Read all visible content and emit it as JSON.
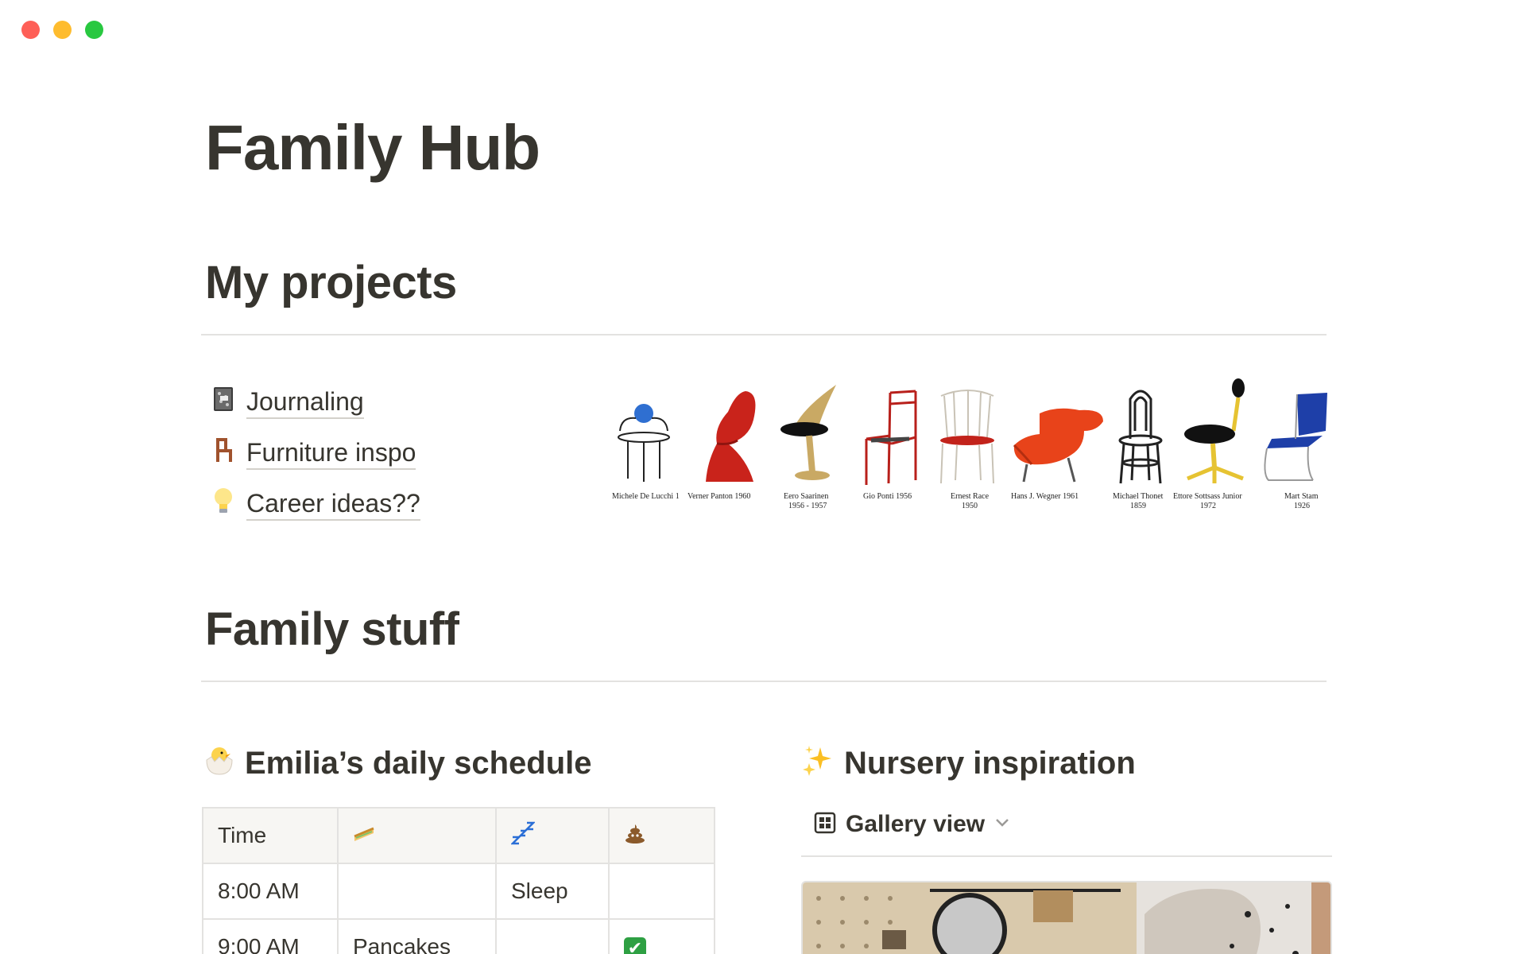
{
  "page": {
    "title": "Family Hub"
  },
  "sections": {
    "projects": {
      "heading": "My projects"
    },
    "family": {
      "heading": "Family stuff"
    }
  },
  "projects": [
    {
      "icon": "notebook-icon",
      "label": "Journaling"
    },
    {
      "icon": "chair-icon",
      "label": "Furniture inspo"
    },
    {
      "icon": "lightbulb-icon",
      "label": "Career ideas??"
    }
  ],
  "chairs": [
    {
      "label": "Michele De Lucchi 1"
    },
    {
      "label": "Verner Panton 1960"
    },
    {
      "label": "Eero Saarinen",
      "label2": "1956 - 1957"
    },
    {
      "label": "Gio Ponti  1956"
    },
    {
      "label": "Ernest Race",
      "label2": "1950"
    },
    {
      "label": "Hans J. Wegner 1961"
    },
    {
      "label": "Michael Thonet",
      "label2": "1859"
    },
    {
      "label": "Ettore Sottsass Junior",
      "label2": "1972"
    },
    {
      "label": "Mart Stam",
      "label2": "1926"
    }
  ],
  "schedule": {
    "heading": "Emilia’s daily schedule",
    "heading_icon": "hatching-chick-icon",
    "columns": [
      {
        "label": "Time",
        "icon": ""
      },
      {
        "label": "",
        "icon": "sandwich-icon"
      },
      {
        "label": "",
        "icon": "zzz-icon"
      },
      {
        "label": "",
        "icon": "poop-icon"
      }
    ],
    "rows": [
      {
        "time": "8:00 AM",
        "food": "",
        "sleep": "Sleep",
        "poo": ""
      },
      {
        "time": "9:00 AM",
        "food": "Pancakes",
        "sleep": "",
        "poo": "✔"
      }
    ]
  },
  "nursery": {
    "heading": "Nursery inspiration",
    "heading_icon": "sparkles-icon",
    "view_label": "Gallery view",
    "view_icon": "gallery-grid-icon"
  },
  "colors": {
    "text": "#37352f",
    "divider": "#e3e2e0",
    "traffic_close": "#fe5f57",
    "traffic_min": "#febc2e",
    "traffic_max": "#28c840",
    "check": "#2ea043"
  }
}
